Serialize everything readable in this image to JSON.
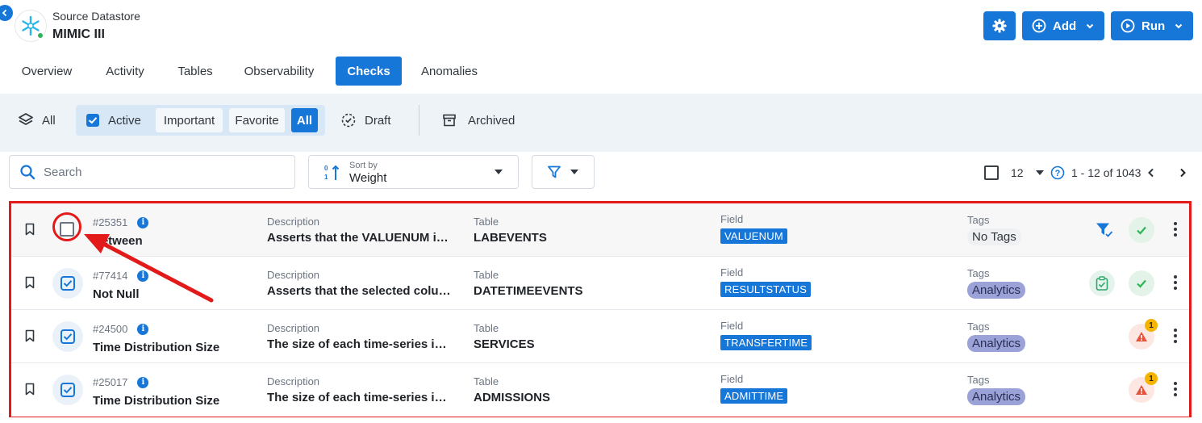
{
  "header": {
    "datastore_label": "Source Datastore",
    "datastore_name": "MIMIC III",
    "add_label": "Add",
    "run_label": "Run"
  },
  "tabs": [
    {
      "label": "Overview"
    },
    {
      "label": "Activity"
    },
    {
      "label": "Tables"
    },
    {
      "label": "Observability"
    },
    {
      "label": "Checks",
      "active": true
    },
    {
      "label": "Anomalies"
    }
  ],
  "filters": {
    "all": "All",
    "active": "Active",
    "important": "Important",
    "favorite": "Favorite",
    "active_all": "All",
    "draft": "Draft",
    "archived": "Archived"
  },
  "search": {
    "placeholder": "Search"
  },
  "sort": {
    "caption": "Sort by",
    "value": "Weight"
  },
  "pagination": {
    "per_page": "12",
    "range": "1 - 12 of 1043"
  },
  "labels": {
    "description": "Description",
    "table": "Table",
    "field": "Field",
    "tags": "Tags"
  },
  "checks": [
    {
      "id": "#25351",
      "name": "Between",
      "description": "Asserts that the VALUENUM in the specified range",
      "table": "LABEVENTS",
      "field": "VALUENUM",
      "tag": "No Tags",
      "tag_style": "none",
      "status_icons": [
        "filter-check-icon",
        "check-icon"
      ]
    },
    {
      "id": "#77414",
      "name": "Not Null",
      "description": "Asserts that the selected column has no null values",
      "table": "DATETIMEEVENTS",
      "field": "RESULTSTATUS",
      "tag": "Analytics",
      "tag_style": "analytics",
      "status_icons": [
        "clipboard-check-icon",
        "check-icon"
      ]
    },
    {
      "id": "#24500",
      "name": "Time Distribution Size",
      "description": "The size of each time-series interval",
      "table": "SERVICES",
      "field": "TRANSFERTIME",
      "tag": "Analytics",
      "tag_style": "analytics",
      "anomaly_count": "1"
    },
    {
      "id": "#25017",
      "name": "Time Distribution Size",
      "description": "The size of each time-series interval",
      "table": "ADMISSIONS",
      "field": "ADMITTIME",
      "tag": "Analytics",
      "tag_style": "analytics",
      "anomaly_count": "1"
    }
  ],
  "colors": {
    "accent": "#1677d9",
    "annotation": "#e21a1a",
    "success": "#2fb457",
    "warning": "#f4b400",
    "danger": "#e5533d"
  }
}
